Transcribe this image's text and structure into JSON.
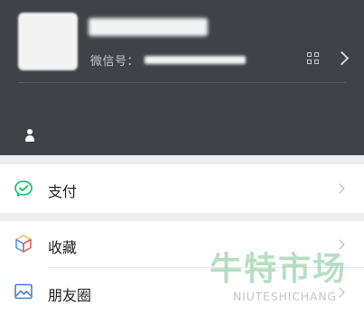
{
  "profile": {
    "wechat_id_label": "微信号："
  },
  "menu": {
    "pay_label": "支付",
    "favorites_label": "收藏",
    "moments_label": "朋友圈"
  },
  "watermark": {
    "title": "牛特市场",
    "subtitle": "NIUTESHICHANG"
  },
  "colors": {
    "header_bg": "#3f4246",
    "page_bg": "#ededed",
    "pay_green": "#07c160",
    "favorites_blue": "#4a90e2",
    "favorites_yellow": "#f5c243",
    "moments_blue": "#4a7fc1"
  },
  "icons": {
    "pay": "pay-check-bubble-icon",
    "favorites": "cube-icon",
    "moments": "photo-frame-icon",
    "qr": "qr-code-icon",
    "status": "person-icon"
  }
}
